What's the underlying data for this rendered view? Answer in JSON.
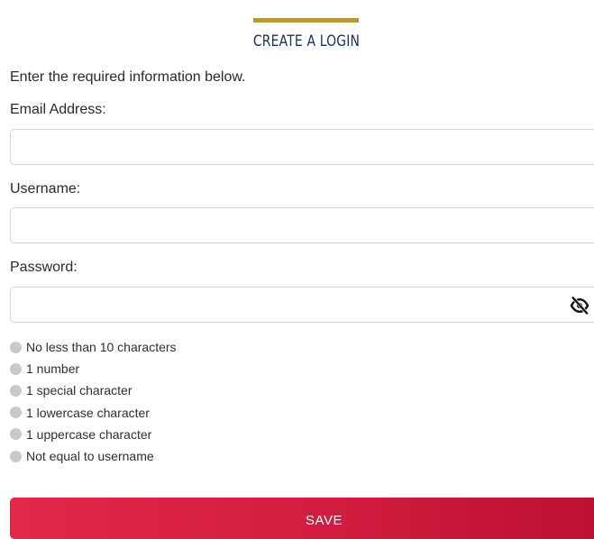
{
  "form": {
    "title": "CREATE A LOGIN",
    "subtitle": "Enter the required information below.",
    "email": {
      "label": "Email Address:",
      "value": "",
      "placeholder": ""
    },
    "username": {
      "label": "Username:",
      "value": "",
      "placeholder": ""
    },
    "password": {
      "label": "Password:",
      "value": "",
      "placeholder": ""
    },
    "password_rules": [
      "No less than 10 characters",
      "1 number",
      "1 special character",
      "1 lowercase character",
      "1 uppercase character",
      "Not equal to username"
    ],
    "save_label": "SAVE"
  },
  "colors": {
    "accent_gold": "#b59a3c",
    "title_navy": "#1f3150",
    "save_red": "#d21d40",
    "rule_dot_inactive": "#c9c9c9"
  },
  "icons": {
    "password_toggle": "eye-slash-icon"
  }
}
